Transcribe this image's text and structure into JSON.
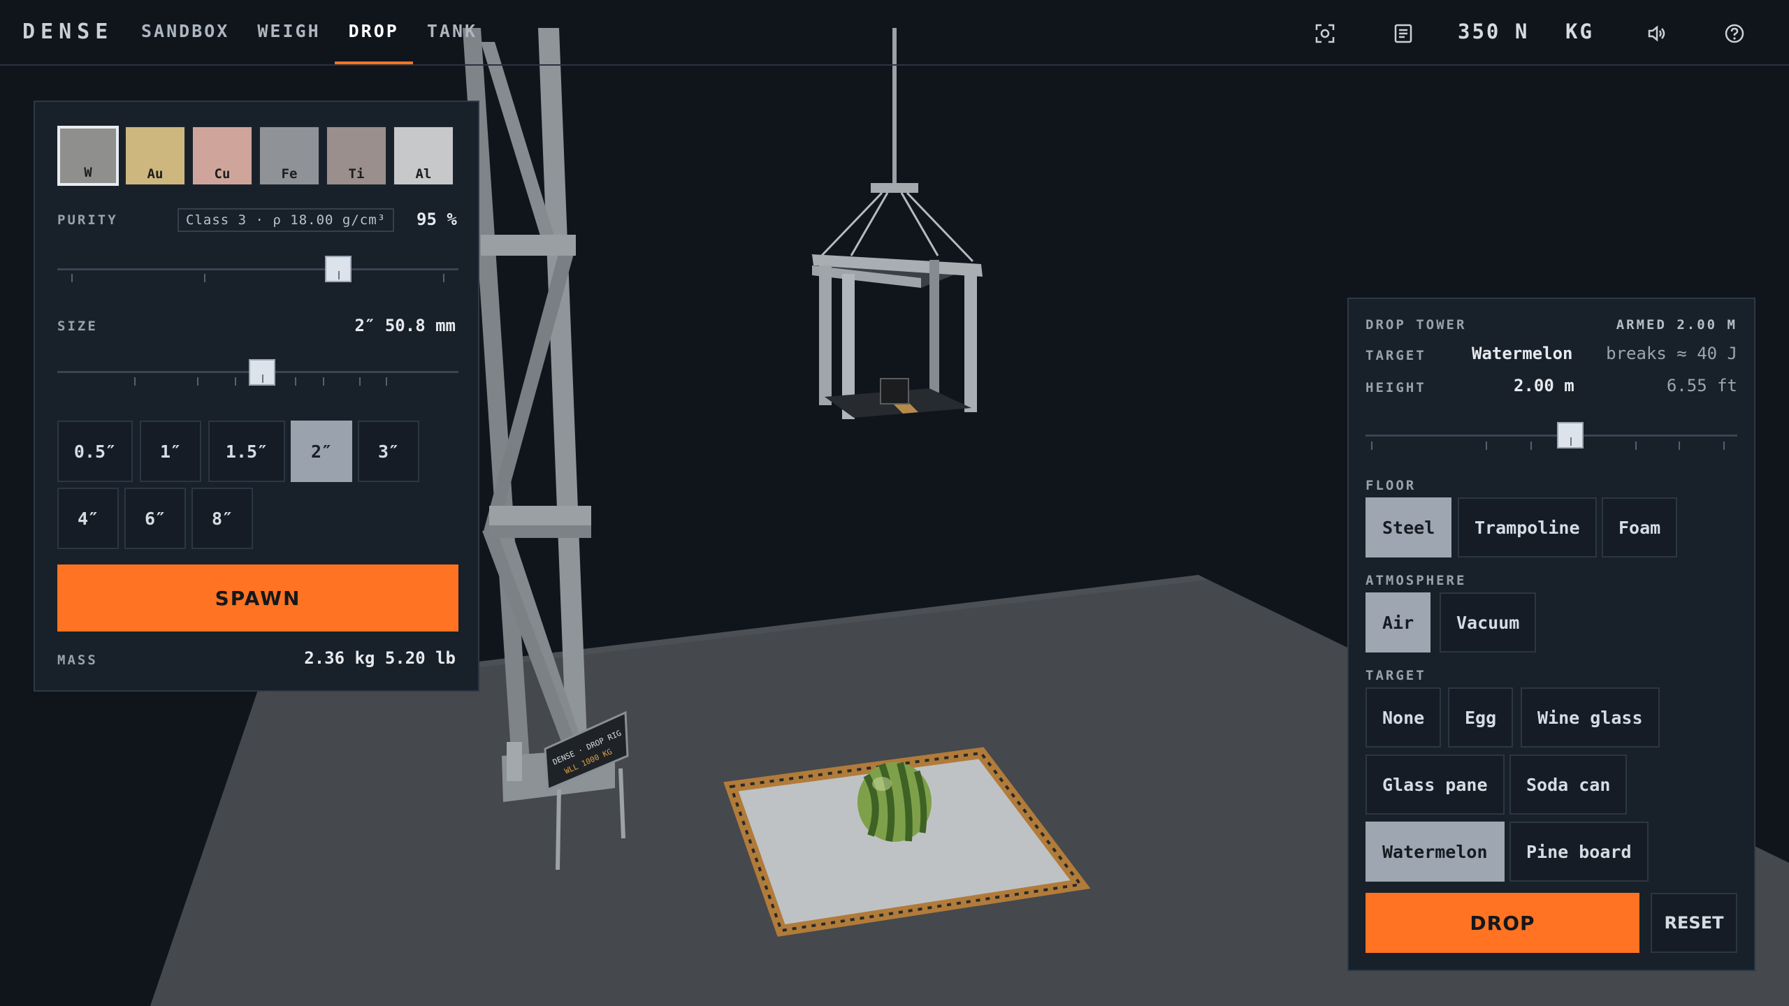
{
  "app": {
    "brand": "DENSE"
  },
  "nav": {
    "tabs": [
      {
        "label": "SANDBOX",
        "active": false
      },
      {
        "label": "WEIGH",
        "active": false
      },
      {
        "label": "DROP",
        "active": true
      },
      {
        "label": "TANK",
        "active": false
      }
    ]
  },
  "toolbar": {
    "force_unit": "350 N",
    "mass_unit": "KG",
    "icons": [
      "screenshot-icon",
      "notes-icon",
      "sound-icon",
      "help-icon"
    ]
  },
  "materials": [
    {
      "symbol": "W",
      "color": "#8f908d",
      "selected": true
    },
    {
      "symbol": "Au",
      "color": "#cdb77e",
      "selected": false
    },
    {
      "symbol": "Cu",
      "color": "#cfa59b",
      "selected": false
    },
    {
      "symbol": "Fe",
      "color": "#8f9398",
      "selected": false
    },
    {
      "symbol": "Ti",
      "color": "#9a8f8c",
      "selected": false
    },
    {
      "symbol": "Al",
      "color": "#c6c8ca",
      "selected": false
    }
  ],
  "purity": {
    "label": "PURITY",
    "class_info": "Class 3 · ρ 18.00 g/cm³",
    "value": "95 %",
    "fraction": 0.7
  },
  "size": {
    "label": "SIZE",
    "value": "2″ 50.8 mm",
    "fraction": 0.51,
    "options": [
      {
        "label": "0.5″",
        "active": false
      },
      {
        "label": "1″",
        "active": false
      },
      {
        "label": "1.5″",
        "active": false
      },
      {
        "label": "2″",
        "active": true
      },
      {
        "label": "3″",
        "active": false
      },
      {
        "label": "4″",
        "active": false
      },
      {
        "label": "6″",
        "active": false
      },
      {
        "label": "8″",
        "active": false
      }
    ]
  },
  "spawn": {
    "label": "SPAWN"
  },
  "mass": {
    "label": "MASS",
    "value": "2.36 kg 5.20 lb"
  },
  "drop_tower": {
    "title": "DROP TOWER",
    "status": "ARMED 2.00 M",
    "target_label": "TARGET",
    "target_value": "Watermelon",
    "target_note": "breaks ≈ 40 J",
    "height_label": "HEIGHT",
    "height_value": "2.00 m",
    "height_ft": "6.55 ft",
    "height_fraction": 0.55,
    "floor_label": "FLOOR",
    "floors": [
      {
        "label": "Steel",
        "active": true
      },
      {
        "label": "Trampoline",
        "active": false
      },
      {
        "label": "Foam",
        "active": false
      }
    ],
    "atmosphere_label": "ATMOSPHERE",
    "atmospheres": [
      {
        "label": "Air",
        "active": true
      },
      {
        "label": "Vacuum",
        "active": false
      }
    ],
    "targets_label": "TARGET",
    "targets": [
      {
        "label": "None",
        "active": false
      },
      {
        "label": "Egg",
        "active": false
      },
      {
        "label": "Wine glass",
        "active": false
      },
      {
        "label": "Glass pane",
        "active": false
      },
      {
        "label": "Soda can",
        "active": false
      },
      {
        "label": "Watermelon",
        "active": true
      },
      {
        "label": "Pine board",
        "active": false
      }
    ],
    "drop_label": "DROP",
    "reset_label": "RESET"
  },
  "rig_sign": {
    "line1": "DENSE · DROP RIG",
    "line2": "WLL 1000 KG"
  }
}
